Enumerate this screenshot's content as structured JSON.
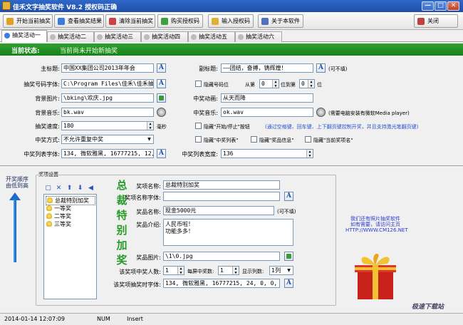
{
  "window": {
    "title": "佳禾文字抽奖软件 V8.2 授权码正确",
    "min": "—",
    "max": "□",
    "close": "✕"
  },
  "toolbar": {
    "buttons": [
      "开始当前抽奖",
      "查看抽奖结果",
      "清除当前抽奖",
      "购买授权码",
      "输入授权码",
      "关于本软件"
    ],
    "close_label": "关闭"
  },
  "tabs": [
    "抽奖活动一",
    "抽奖活动二",
    "抽奖活动三",
    "抽奖活动四",
    "抽奖活动五",
    "抽奖活动六"
  ],
  "status": {
    "label": "当前状态:",
    "value": "当前尚未开始新抽奖"
  },
  "form": {
    "main_title_label": "主标题:",
    "main_title": "中国XX集团公司2013年年会",
    "sub_title_label": "副标题:",
    "sub_title": "——团结，奋搏，铸辉煌！",
    "sub_title_note": "(可不填)",
    "number_font_label": "抽奖号码字体:",
    "number_font": "C:\\Program Files\\佳禾\\佳禾抽号抽奖",
    "hide_number_label": "隐藏号码位",
    "from_label": "从第",
    "from_value": "0",
    "to_label": "位到第",
    "to_value": "0",
    "pos_label": "位",
    "bg_image_label": "背景图片:",
    "bg_image": "\\bking\\欢庆.jpg",
    "win_anim_label": "中奖动画:",
    "win_anim": "从天而降",
    "bg_music_label": "背景音乐:",
    "bg_music": "bk.wav",
    "win_music_label": "中奖音乐:",
    "win_music": "ok.wav",
    "music_note": "(需要电脑安装有微软Media player)",
    "speed_label": "抽奖速度:",
    "speed": "180",
    "speed_unit": "毫秒",
    "hide_start_stop": "隐藏\"开始/停止\"按钮",
    "start_stop_note": "(通过空格键、回车键、上下翻页键控制开奖，并且支持激光笔翻页键)",
    "mode_label": "中奖方式:",
    "mode": "不允许重复中奖",
    "hide_list": "隐藏\"中奖列表\"",
    "hide_info": "隐藏\"奖品信息\"",
    "hide_name": "隐藏\"当前奖项名\"",
    "list_font_label": "中奖列表字体:",
    "list_font": "134, 微软雅黑, 16777215, 12, 1, 0, 0, 0",
    "list_width_label": "中奖列表宽度:",
    "list_width": "136"
  },
  "prize": {
    "order_text": "开奖顺序由低到高",
    "section_label": "奖项设置",
    "tree": [
      "总裁特别加奖",
      "一等奖",
      "二等奖",
      "三等奖"
    ],
    "vertical_title": [
      "总",
      "裁",
      "特",
      "别",
      "加",
      "奖"
    ],
    "name_label": "奖项名称:",
    "name": "总裁特别加奖",
    "name_font_label": "奖项名称字体:",
    "name_font": "",
    "item_label": "奖品名称:",
    "item": "现金5000元",
    "item_note": "(可不填)",
    "intro_label": "奖品介绍:",
    "intro_lines": [
      "人民币啦！",
      "功能多多！"
    ],
    "image_label": "奖品图片:",
    "image": "\\1\\0.jpg",
    "count_label": "该奖项中奖人数:",
    "count": "1",
    "per_draw_label": "每屏中奖数:",
    "per_draw": "1",
    "columns_label": "显示列数:",
    "columns": "1列",
    "list_font_label": "该奖项抽奖时字体:",
    "list_font": "134, 微软雅黑, 16777215, 24, 0, 0, 0, 0"
  },
  "promo_lines": [
    "我们还有照片抽奖软件",
    "如有需要，请访问主页",
    "HTTP://WWW.CM126.NET"
  ],
  "watermark": "极速下载站",
  "footer": {
    "datetime": "2014-01-14 12:07:09",
    "caps": "NUM",
    "insert": "Insert"
  },
  "colors": {
    "status_green": "#188018",
    "accent_blue": "#2a50d0",
    "title_green": "#2a9a2a"
  }
}
